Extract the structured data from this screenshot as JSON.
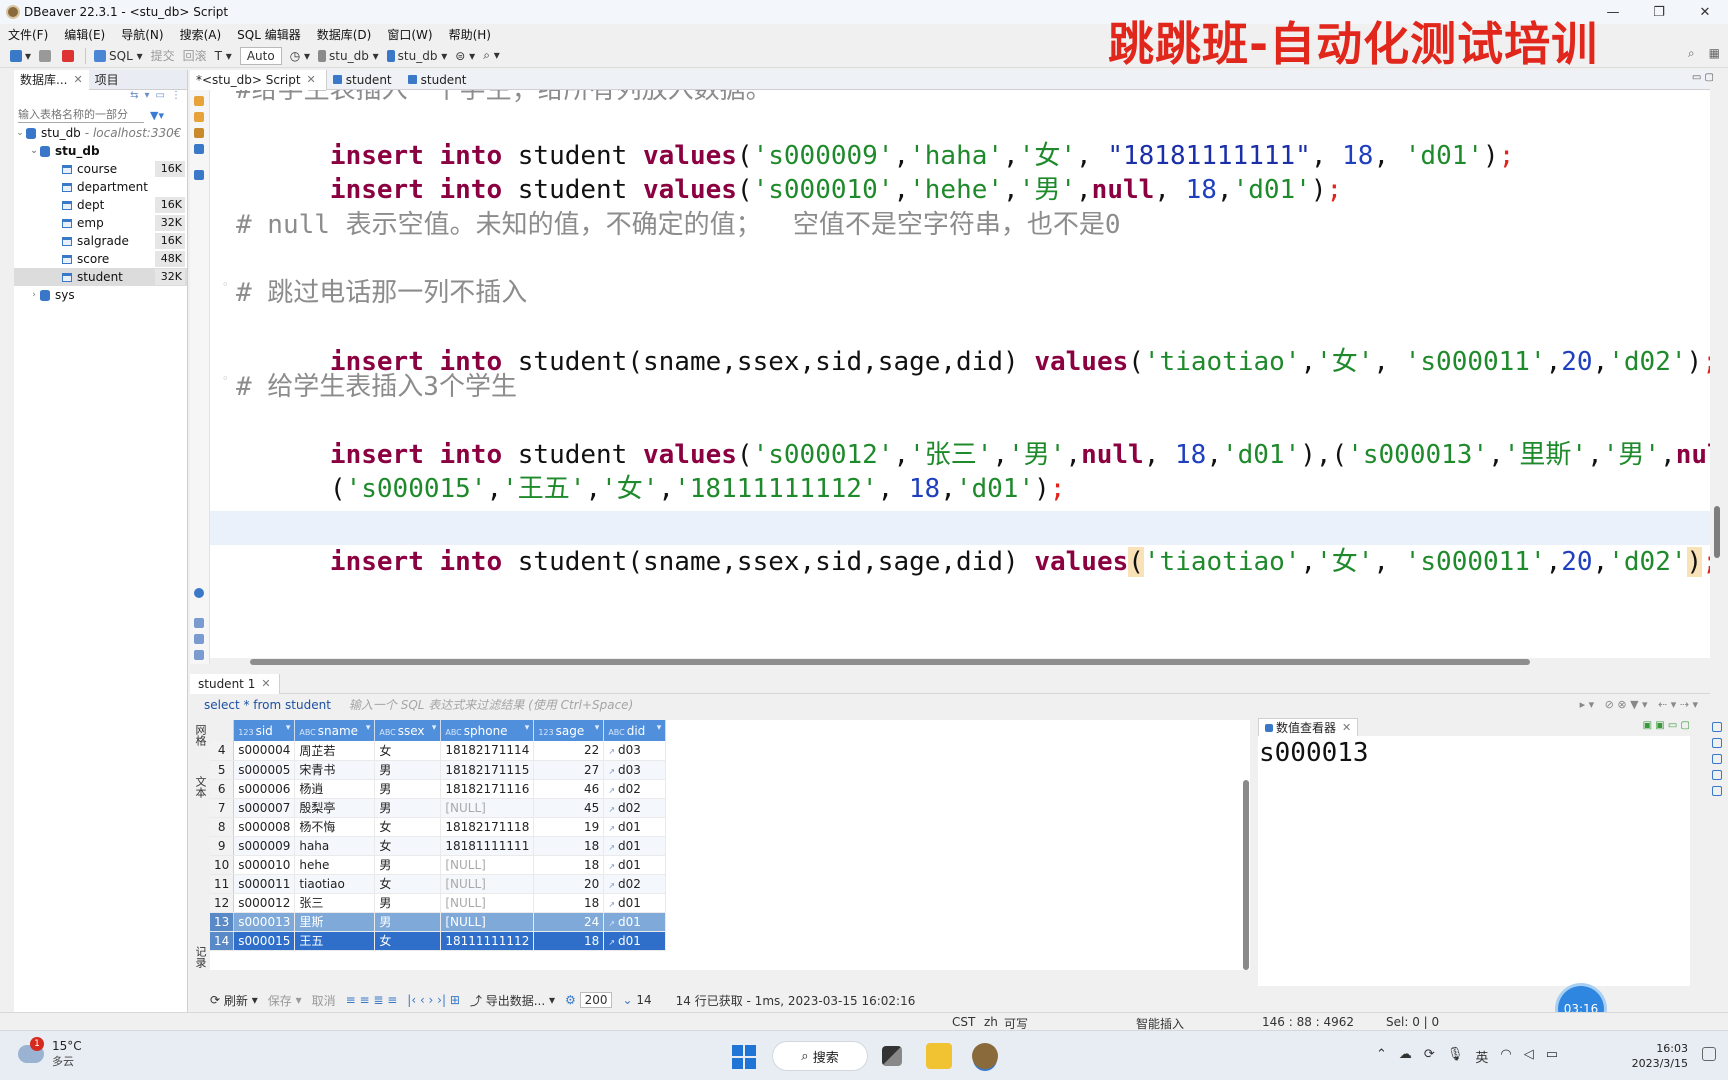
{
  "window": {
    "title": "DBeaver 22.3.1 - <stu_db> Script",
    "minimize": "—",
    "restore": "❐",
    "close": "✕"
  },
  "brand": "跳跳班-自动化测试培训",
  "menu": [
    "文件(F)",
    "编辑(E)",
    "导航(N)",
    "搜索(A)",
    "SQL 编辑器",
    "数据库(D)",
    "窗口(W)",
    "帮助(H)"
  ],
  "toolbar": {
    "sql": "SQL",
    "commit": "提交",
    "rollback": "回滚",
    "auto": "Auto",
    "datasource": "stu_db",
    "schema": "stu_db"
  },
  "navigator": {
    "tab_db": "数据库...",
    "tab_project": "项目",
    "filter_placeholder": "输入表格名称的一部分",
    "connection": "stu_db",
    "host": "- localhost:330€",
    "database": "stu_db",
    "tables": [
      {
        "name": "course",
        "size": "16K"
      },
      {
        "name": "department",
        "size": ""
      },
      {
        "name": "dept",
        "size": "16K"
      },
      {
        "name": "emp",
        "size": "32K"
      },
      {
        "name": "salgrade",
        "size": "16K"
      },
      {
        "name": "score",
        "size": "48K"
      },
      {
        "name": "student",
        "size": "32K"
      }
    ],
    "sys": "sys"
  },
  "editor_tabs": [
    "*<stu_db> Script",
    "student",
    "student"
  ],
  "code": {
    "l0": "#给学生表插入一个学生；给所有列放入数据。",
    "c_null": "# null 表示空值。未知的值，不确定的值；  空值不是空字符串，也不是0",
    "c_skip": "# 跳过电话那一列不插入",
    "c_three": "# 给学生表插入3个学生",
    "insert_into": "insert into",
    "student": " student ",
    "values": "values",
    "cols": "student(sname,ssex,sid,sage,did) ",
    "l1": {
      "sid": "'s000009'",
      "name": "'haha'",
      "sex": "'女'",
      "phone": "\"18181111111\"",
      "age": "18",
      "did": "'d01'"
    },
    "l2": {
      "sid": "'s000010'",
      "name": "'hehe'",
      "sex": "'男'",
      "null": "null",
      "age": "18",
      "did": "'d01'"
    },
    "l3": {
      "name": "'tiaotiao'",
      "sex": "'女'",
      "sid": "'s000011'",
      "age": "20",
      "did": "'d02'"
    },
    "l4": {
      "sid": "'s000012'",
      "name": "'张三'",
      "sex": "'男'",
      "null": "null",
      "age": "18",
      "did": "'d01'",
      "sid2": "'s000013'",
      "name2": "'里斯'",
      "sex2": "'男'",
      "null2": "null,"
    },
    "l5": {
      "sid": "'s000015'",
      "name": "'王五'",
      "sex": "'女'",
      "phone": "'18111111112'",
      "age": "18",
      "did": "'d01'"
    }
  },
  "results": {
    "tab": "student 1",
    "query": "select * from student",
    "filter_hint": "输入一个 SQL 表达式来过滤结果 (使用 Ctrl+Space)",
    "vtabs": [
      "网格",
      "文本",
      "记录"
    ],
    "columns": [
      "sid",
      "sname",
      "ssex",
      "sphone",
      "sage",
      "did"
    ],
    "rows": [
      {
        "n": "4",
        "sid": "s000004",
        "sname": "周芷若",
        "ssex": "女",
        "sphone": "18182171114",
        "sage": "22",
        "did": "d03"
      },
      {
        "n": "5",
        "sid": "s000005",
        "sname": "宋青书",
        "ssex": "男",
        "sphone": "18182171115",
        "sage": "27",
        "did": "d03"
      },
      {
        "n": "6",
        "sid": "s000006",
        "sname": "杨逍",
        "ssex": "男",
        "sphone": "18182171116",
        "sage": "46",
        "did": "d02"
      },
      {
        "n": "7",
        "sid": "s000007",
        "sname": "殷梨亭",
        "ssex": "男",
        "sphone": "[NULL]",
        "sage": "45",
        "did": "d02"
      },
      {
        "n": "8",
        "sid": "s000008",
        "sname": "杨不悔",
        "ssex": "女",
        "sphone": "18182171118",
        "sage": "19",
        "did": "d01"
      },
      {
        "n": "9",
        "sid": "s000009",
        "sname": "haha",
        "ssex": "女",
        "sphone": "18181111111",
        "sage": "18",
        "did": "d01"
      },
      {
        "n": "10",
        "sid": "s000010",
        "sname": "hehe",
        "ssex": "男",
        "sphone": "[NULL]",
        "sage": "18",
        "did": "d01"
      },
      {
        "n": "11",
        "sid": "s000011",
        "sname": "tiaotiao",
        "ssex": "女",
        "sphone": "[NULL]",
        "sage": "20",
        "did": "d02"
      },
      {
        "n": "12",
        "sid": "s000012",
        "sname": "张三",
        "ssex": "男",
        "sphone": "[NULL]",
        "sage": "18",
        "did": "d01"
      },
      {
        "n": "13",
        "sid": "s000013",
        "sname": "里斯",
        "ssex": "男",
        "sphone": "[NULL]",
        "sage": "24",
        "did": "d01"
      },
      {
        "n": "14",
        "sid": "s000015",
        "sname": "王五",
        "ssex": "女",
        "sphone": "18111111112",
        "sage": "18",
        "did": "d01"
      }
    ],
    "viewer_tab": "数值查看器",
    "viewer_value": "s000013",
    "status": {
      "refresh": "刷新",
      "save": "保存",
      "cancel": "取消",
      "export": "导出数据...",
      "fetch_size": "200",
      "row_count": "14",
      "message": "14 行已获取 - 1ms, 2023-03-15 16:02:16"
    },
    "timer": "03:16"
  },
  "app_status": {
    "tz": "CST",
    "lang": "zh",
    "mode": "可写",
    "insert": "智能插入",
    "pos": "146 : 88 : 4962",
    "sel": "Sel: 0 | 0"
  },
  "taskbar": {
    "badge": "1",
    "temp": "15°C",
    "weather": "多云",
    "search": "搜索",
    "ime": "英",
    "time": "16:03",
    "date": "2023/3/15"
  }
}
